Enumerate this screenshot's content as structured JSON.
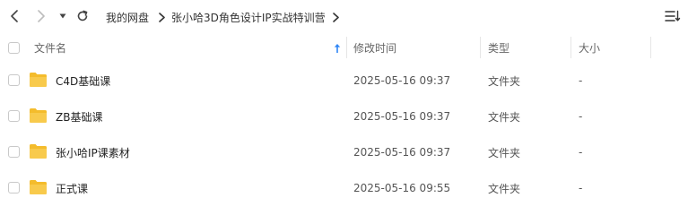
{
  "breadcrumb": {
    "items": [
      {
        "label": "我的网盘"
      },
      {
        "label": "张小哈3D角色设计IP实战特训营"
      }
    ]
  },
  "columns": {
    "name": "文件名",
    "modified": "修改时间",
    "type": "类型",
    "size": "大小"
  },
  "files": [
    {
      "name": "C4D基础课",
      "modified": "2025-05-16 09:37",
      "type": "文件夹",
      "size": "-"
    },
    {
      "name": "ZB基础课",
      "modified": "2025-05-16 09:37",
      "type": "文件夹",
      "size": "-"
    },
    {
      "name": "张小哈IP课素材",
      "modified": "2025-05-16 09:37",
      "type": "文件夹",
      "size": "-"
    },
    {
      "name": "正式课",
      "modified": "2025-05-16 09:55",
      "type": "文件夹",
      "size": "-"
    }
  ],
  "colors": {
    "folder": "#f7c73e",
    "sort_arrow": "#2f86f6"
  },
  "icons": [
    "chevron-left-icon",
    "chevron-right-icon",
    "dropdown-icon",
    "refresh-icon",
    "breadcrumb-chevron-icon",
    "sort-arrow-icon",
    "list-view-icon",
    "folder-icon"
  ]
}
